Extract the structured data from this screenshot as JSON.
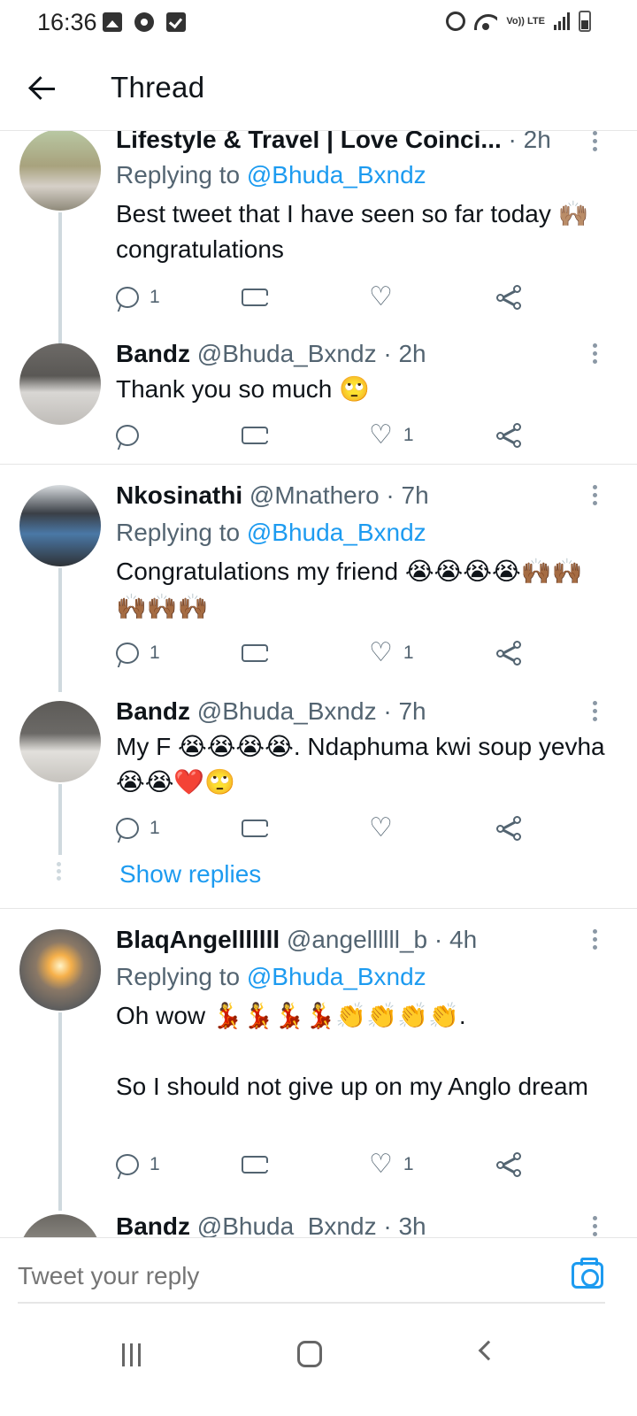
{
  "status_bar": {
    "time": "16:36",
    "left_icons": [
      "image-icon",
      "gear-icon",
      "checkbox-icon"
    ],
    "right_icons": [
      "alarm-icon",
      "wifi-icon",
      "volte-icon",
      "signal-icon",
      "battery-icon"
    ],
    "volte_text": "Vo)) LTE"
  },
  "header": {
    "title": "Thread"
  },
  "tweets": [
    {
      "name": "Lifestyle & Travel | Love Coinci...",
      "handle": "",
      "time": "· 2h",
      "replying_prefix": "Replying to ",
      "replying_to": "@Bhuda_Bxndz",
      "text": "Best tweet that I have seen so far today 🙌🏽 congratulations",
      "replies": "1",
      "retweets": "",
      "likes": ""
    },
    {
      "name": "Bandz",
      "handle": "@Bhuda_Bxndz",
      "time": "· 2h",
      "replying_prefix": "",
      "replying_to": "",
      "text": "Thank you so much 🙄",
      "replies": "",
      "retweets": "",
      "likes": "1"
    },
    {
      "name": "Nkosinathi",
      "handle": "@Mnathero",
      "time": "· 7h",
      "replying_prefix": "Replying to ",
      "replying_to": "@Bhuda_Bxndz",
      "text": "Congratulations my friend 😭😭😭😭🙌🏾🙌🏾🙌🏾🙌🏾🙌🏾",
      "replies": "1",
      "retweets": "",
      "likes": "1"
    },
    {
      "name": "Bandz",
      "handle": "@Bhuda_Bxndz",
      "time": "· 7h",
      "replying_prefix": "",
      "replying_to": "",
      "text": "My F 😭😭😭😭. Ndaphuma kwi soup yevha 😭😭❤️🙄",
      "replies": "1",
      "retweets": "",
      "likes": ""
    },
    {
      "name": "BlaqAngelllllll",
      "handle": "@angellllll_b",
      "time": "· 4h",
      "replying_prefix": "Replying to ",
      "replying_to": "@Bhuda_Bxndz",
      "text": "Oh wow 💃💃💃💃👏👏👏👏.",
      "text2": "So I should not give up on my Anglo dream",
      "replies": "1",
      "retweets": "",
      "likes": "1"
    },
    {
      "name": "Bandz",
      "handle": "@Bhuda_Bxndz",
      "time": "· 3h"
    }
  ],
  "show_replies_label": "Show replies",
  "compose": {
    "placeholder": "Tweet your reply"
  }
}
